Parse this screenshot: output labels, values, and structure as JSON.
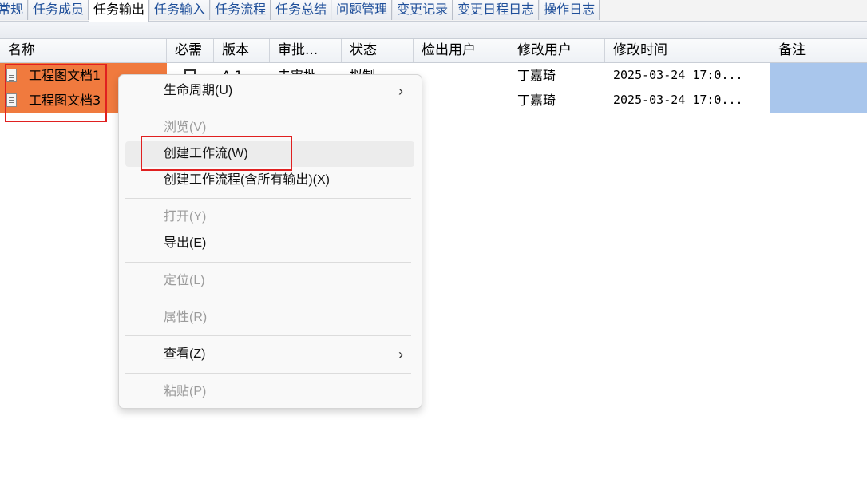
{
  "tabs": [
    "常规",
    "任务成员",
    "任务输出",
    "任务输入",
    "任务流程",
    "任务总结",
    "问题管理",
    "变更记录",
    "变更日程日志",
    "操作日志"
  ],
  "active_tab": "任务输出",
  "columns": [
    "名称",
    "必需",
    "版本",
    "审批...",
    "状态",
    "检出用户",
    "修改用户",
    "修改时间",
    "备注"
  ],
  "rows": [
    {
      "name": "工程图文档1",
      "version": "A.1",
      "approval": "未审批",
      "status": "拟制",
      "modified_by": "丁嘉琦",
      "modified_time": "2025-03-24 17:0..."
    },
    {
      "name": "工程图文档3",
      "modified_by": "丁嘉琦",
      "modified_time": "2025-03-24 17:0..."
    }
  ],
  "context_menu": {
    "lifecycle": "生命周期(U)",
    "browse": "浏览(V)",
    "create_workflow": "创建工作流(W)",
    "create_workflow_all": "创建工作流程(含所有输出)(X)",
    "open": "打开(Y)",
    "export": "导出(E)",
    "locate": "定位(L)",
    "properties": "属性(R)",
    "view": "查看(Z)",
    "paste": "粘贴(P)"
  },
  "colors": {
    "selected_row": "#f07a3e",
    "remark_selected": "#a9c6ec",
    "highlight_box": "#e02020"
  }
}
